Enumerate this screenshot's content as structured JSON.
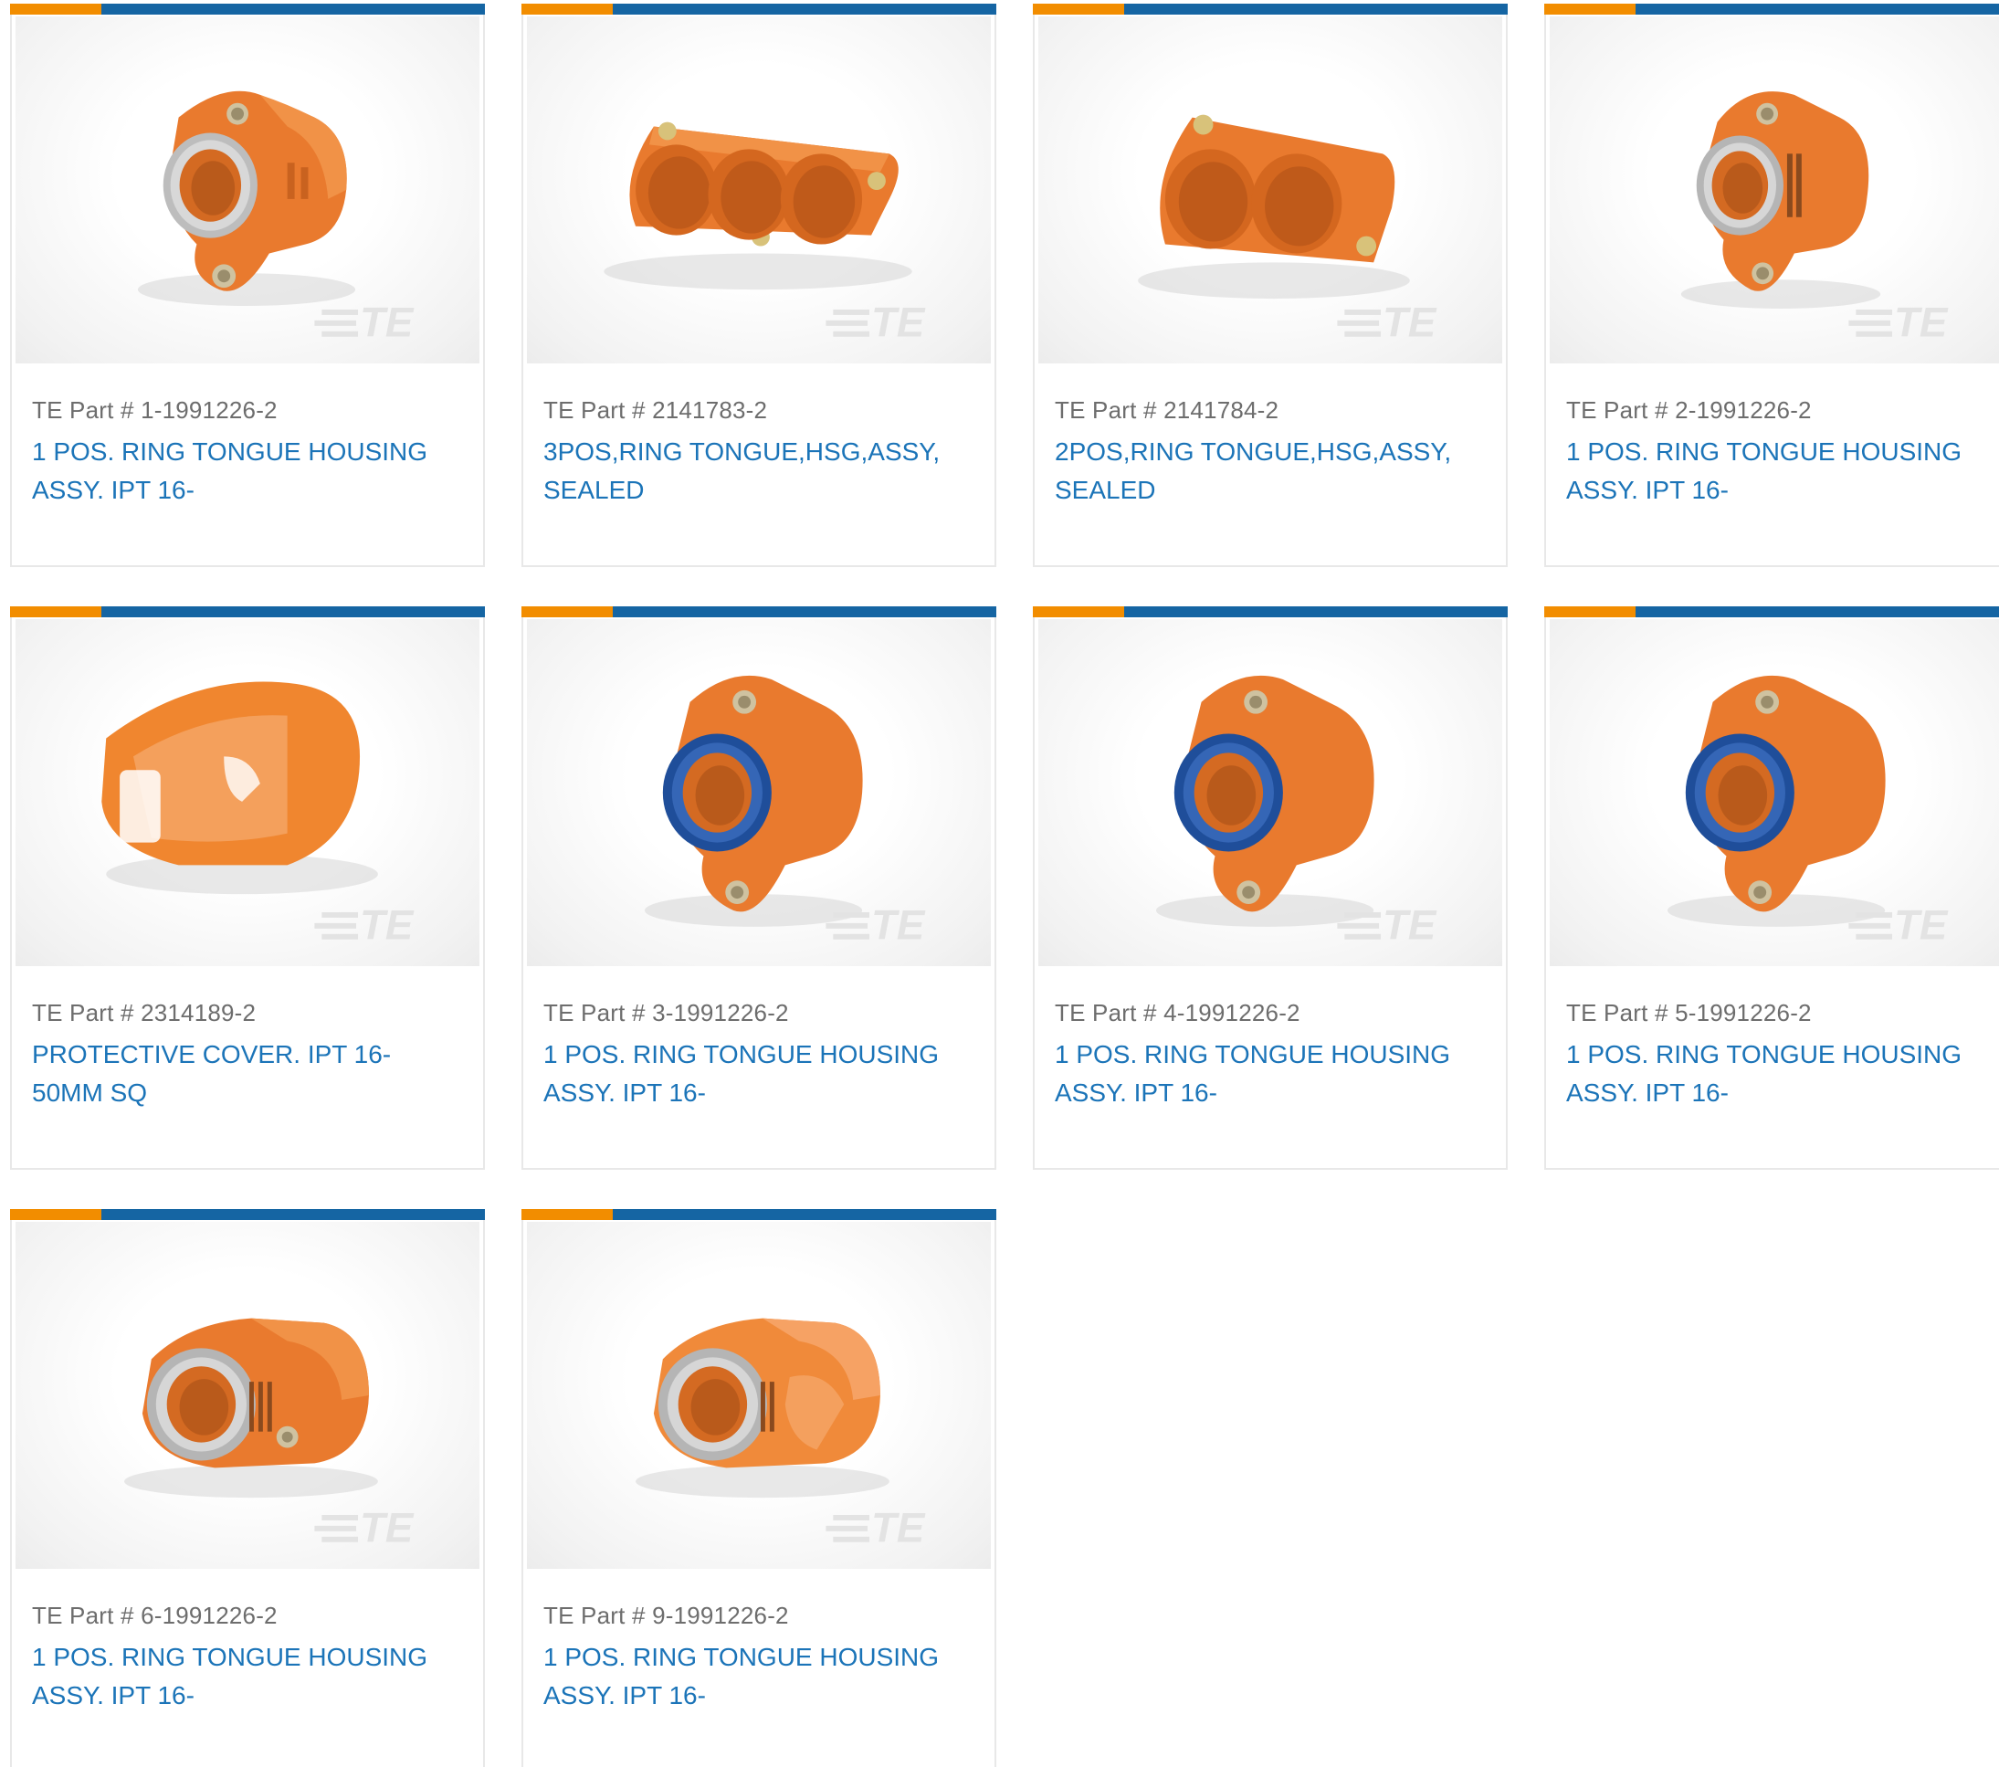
{
  "colors": {
    "accent_orange": "#f28d00",
    "accent_blue": "#1565a3",
    "link_blue": "#1b74b8",
    "part_gray": "#6d6d6d",
    "housing_orange": "#e97a2e"
  },
  "products": [
    {
      "part_prefix": "TE Part #",
      "part_number": "1-1991226-2",
      "description": "1 POS. RING TONGUE HOUSING ASSY. IPT 16-",
      "image": "single-housing-gray-seal",
      "watermark": "TE"
    },
    {
      "part_prefix": "TE Part #",
      "part_number": "2141783-2",
      "description": "3POS,RING TONGUE,HSG,ASSY, SEALED",
      "image": "three-position-housing",
      "watermark": "TE"
    },
    {
      "part_prefix": "TE Part #",
      "part_number": "2141784-2",
      "description": "2POS,RING TONGUE,HSG,ASSY, SEALED",
      "image": "two-position-housing",
      "watermark": "TE"
    },
    {
      "part_prefix": "TE Part #",
      "part_number": "2-1991226-2",
      "description": "1 POS. RING TONGUE HOUSING ASSY. IPT 16-",
      "image": "single-housing-gray-seal",
      "watermark": "TE"
    },
    {
      "part_prefix": "TE Part #",
      "part_number": "2314189-2",
      "description": "PROTECTIVE COVER. IPT 16-50MM SQ",
      "image": "protective-cover",
      "watermark": "TE"
    },
    {
      "part_prefix": "TE Part #",
      "part_number": "3-1991226-2",
      "description": "1 POS. RING TONGUE HOUSING ASSY. IPT 16-",
      "image": "single-housing-blue-seal",
      "watermark": "TE"
    },
    {
      "part_prefix": "TE Part #",
      "part_number": "4-1991226-2",
      "description": "1 POS. RING TONGUE HOUSING ASSY. IPT 16-",
      "image": "single-housing-blue-seal",
      "watermark": "TE"
    },
    {
      "part_prefix": "TE Part #",
      "part_number": "5-1991226-2",
      "description": "1 POS. RING TONGUE HOUSING ASSY. IPT 16-",
      "image": "single-housing-blue-seal",
      "watermark": "TE"
    },
    {
      "part_prefix": "TE Part #",
      "part_number": "6-1991226-2",
      "description": "1 POS. RING TONGUE HOUSING ASSY. IPT 16-",
      "image": "angled-housing-gray-seal",
      "watermark": "TE"
    },
    {
      "part_prefix": "TE Part #",
      "part_number": "9-1991226-2",
      "description": "1 POS. RING TONGUE HOUSING ASSY. IPT 16-",
      "image": "angled-housing-gray-seal",
      "watermark": "TE"
    }
  ]
}
